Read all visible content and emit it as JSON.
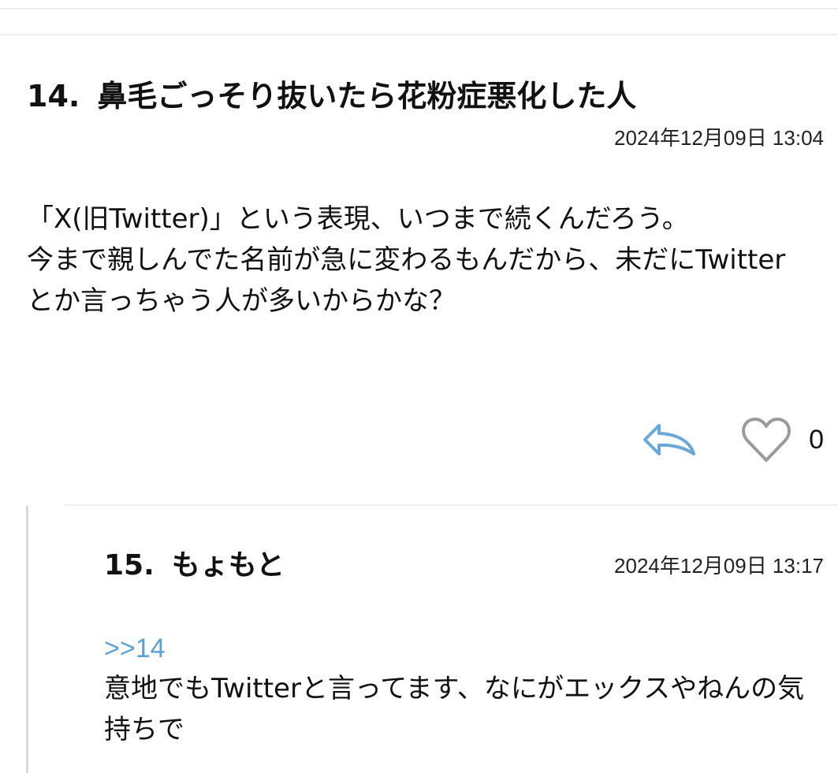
{
  "post": {
    "number": "14.",
    "title": "鼻毛ごっそり抜いたら花粉症悪化した人",
    "date": "2024年12月09日 13:04",
    "body": "「X(旧Twitter)」という表現、いつまで続くんだろう。\n今まで親しんでた名前が急に変わるもんだから、未だにTwitterとか言っちゃう人が多いからかな？",
    "reply_icon": "reply-arrow-icon",
    "like_icon": "heart-outline-icon",
    "like_count": "0"
  },
  "reply": {
    "number": "15.",
    "name": "もょもと",
    "date": "2024年12月09日 13:17",
    "anchor": ">>14",
    "body": "意地でもTwitterと言ってます、なにがエックスやねんの気持ちで"
  },
  "colors": {
    "accent_link": "#5b9fd3",
    "reply_icon": "#6aa6d6",
    "heart_icon": "#9a9a9a",
    "divider": "#efefef"
  }
}
